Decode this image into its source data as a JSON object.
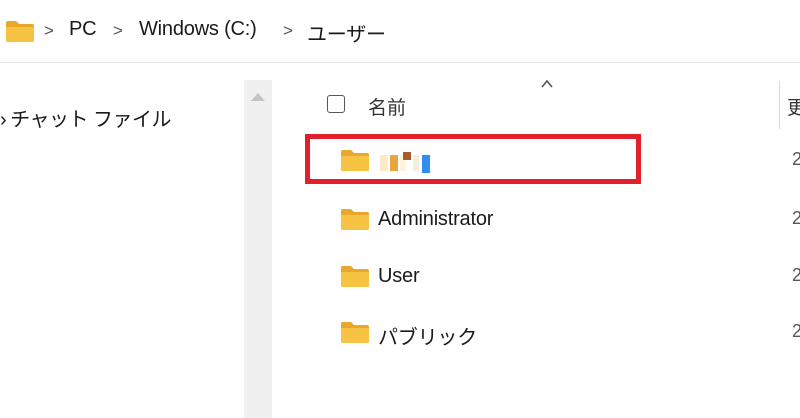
{
  "address_bar": {
    "crumbs": [
      "PC",
      "Windows (C:)",
      "ユーザー"
    ],
    "separator": ">"
  },
  "nav_pane": {
    "item_lead": "›",
    "item_label": "チャット ファイル"
  },
  "columns": {
    "name": "名前",
    "date_partial": "更"
  },
  "rows": [
    {
      "name": "",
      "date_partial": "2",
      "redacted": true
    },
    {
      "name": "Administrator",
      "date_partial": "2"
    },
    {
      "name": "User",
      "date_partial": "2"
    },
    {
      "name": "パブリック",
      "date_partial": "2"
    }
  ],
  "icons": {
    "folder": "folder-icon",
    "separator": "chevron-right-icon",
    "sort": "chevron-up-icon"
  },
  "colors": {
    "highlight": "#e0202a",
    "folder": "#f6c343",
    "folder_dark": "#e8a92b"
  }
}
